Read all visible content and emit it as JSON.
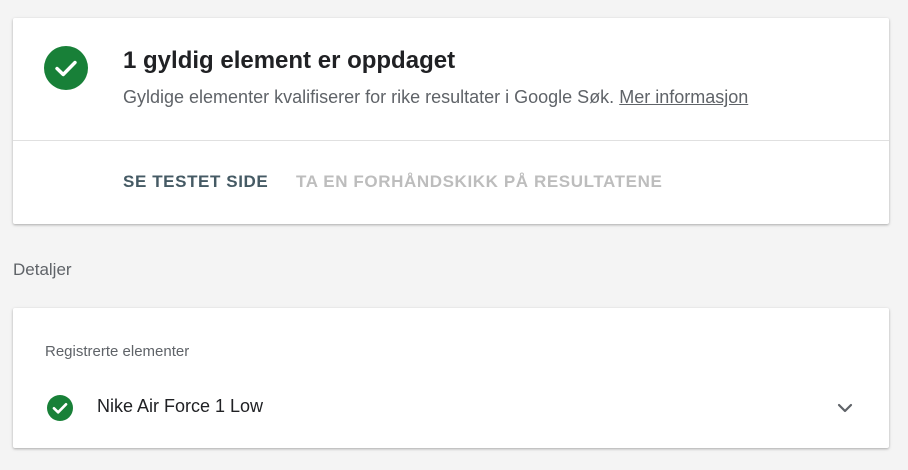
{
  "colors": {
    "success": "#188038",
    "primary_text": "#202124",
    "secondary_text": "#5f6368",
    "action_active": "#455a64",
    "action_disabled": "#bdbdbd"
  },
  "summary": {
    "icon": "check-circle-icon",
    "title": "1 gyldig element er oppdaget",
    "description": "Gyldige elementer kvalifiserer for rike resultater i Google Søk.",
    "link_label": "Mer informasjon",
    "actions": {
      "view_tested_page": "SE TESTET SIDE",
      "preview_results": "TA EN FORHÅNDSKIKK PÅ RESULTATENE"
    }
  },
  "details": {
    "heading": "Detaljer",
    "detected_label": "Registrerte elementer",
    "items": [
      {
        "name": "Nike Air Force 1 Low",
        "status_icon": "check-circle-icon",
        "expand_icon": "chevron-down-icon"
      }
    ]
  }
}
